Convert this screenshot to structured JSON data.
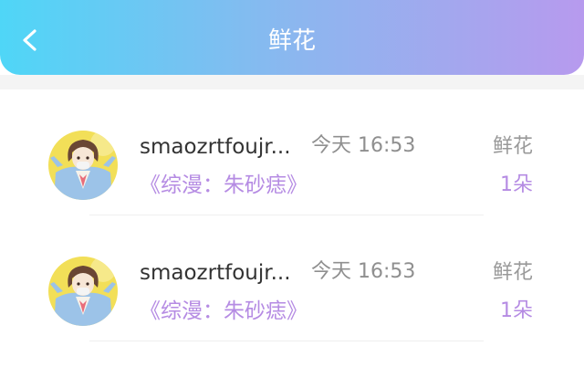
{
  "header": {
    "title": "鲜花",
    "back_icon": "chevron-left-icon",
    "gradient": [
      "#4fd6f7",
      "#8bb7ef",
      "#b79aee"
    ]
  },
  "records": [
    {
      "username": "smaozrtfoujr...",
      "time": "今天 16:53",
      "book_title": "《综漫：朱砂痣》",
      "gift_type": "鲜花",
      "gift_count": "1朵"
    },
    {
      "username": "smaozrtfoujr...",
      "time": "今天 16:53",
      "book_title": "《综漫：朱砂痣》",
      "gift_type": "鲜花",
      "gift_count": "1朵"
    }
  ],
  "colors": {
    "accent": "#b58be3",
    "text": "#333333",
    "muted": "#8f8f8f"
  }
}
